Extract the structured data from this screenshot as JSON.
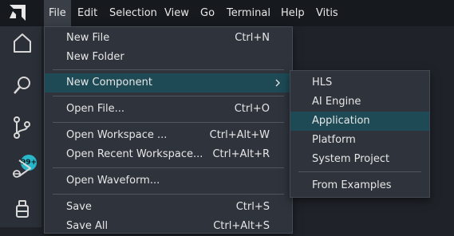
{
  "menubar": {
    "items": [
      "File",
      "Edit",
      "Selection",
      "View",
      "Go",
      "Terminal",
      "Help",
      "Vitis"
    ],
    "active_index": 0
  },
  "activity_bar": {
    "icons": [
      "home-icon",
      "search-icon",
      "source-control-icon",
      "run-debug-icon",
      "extensions-icon"
    ],
    "badge": "99+"
  },
  "file_menu": {
    "items": [
      {
        "label": "New File",
        "shortcut": "Ctrl+N"
      },
      {
        "label": "New Folder",
        "shortcut": ""
      },
      {
        "label": "New Component",
        "shortcut": "",
        "submenu": true,
        "highlighted": true
      },
      {
        "label": "Open File...",
        "shortcut": "Ctrl+O"
      },
      {
        "label": "Open Workspace ...",
        "shortcut": "Ctrl+Alt+W"
      },
      {
        "label": "Open Recent Workspace...",
        "shortcut": "Ctrl+Alt+R"
      },
      {
        "label": "Open Waveform...",
        "shortcut": ""
      },
      {
        "label": "Save",
        "shortcut": "Ctrl+S"
      },
      {
        "label": "Save All",
        "shortcut": "Ctrl+Alt+S"
      }
    ]
  },
  "new_component_submenu": {
    "items": [
      {
        "label": "HLS"
      },
      {
        "label": "AI Engine"
      },
      {
        "label": "Application",
        "highlighted": true
      },
      {
        "label": "Platform"
      },
      {
        "label": "System Project"
      },
      {
        "label": "From Examples"
      }
    ]
  },
  "colors": {
    "menubar_bg": "#16191e",
    "menu_bg": "#2f343c",
    "highlight": "#1e4a55",
    "badge": "#2ab7c9"
  }
}
